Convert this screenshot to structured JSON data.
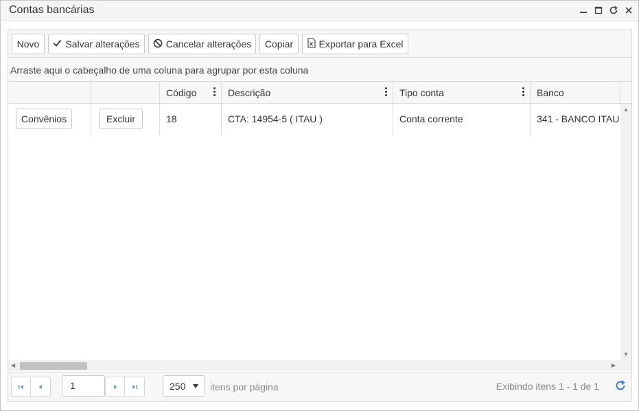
{
  "window": {
    "title": "Contas bancárias"
  },
  "toolbar": {
    "new_label": "Novo",
    "save_label": "Salvar alterações",
    "cancel_label": "Cancelar alterações",
    "copy_label": "Copiar",
    "export_label": "Exportar para Excel"
  },
  "grouping": {
    "hint": "Arraste aqui o cabeçalho de uma coluna para agrupar por esta coluna"
  },
  "columns": [
    {
      "label": ""
    },
    {
      "label": ""
    },
    {
      "label": "Código"
    },
    {
      "label": "Descrição"
    },
    {
      "label": "Tipo conta"
    },
    {
      "label": "Banco"
    }
  ],
  "rows": [
    {
      "convenios_label": "Convênios",
      "excluir_label": "Excluir",
      "codigo": "18",
      "descricao": "CTA: 14954-5 ( ITAU )",
      "tipo_conta": "Conta corrente",
      "banco": "341 - BANCO ITAU"
    }
  ],
  "pager": {
    "page": "1",
    "page_size": "250",
    "items_per_page_label": "itens por página",
    "info": "Exibindo itens 1 - 1 de 1"
  },
  "colors": {
    "accent": "#3f7fc8",
    "border": "#c9c9c9",
    "toolbar_bg": "#f7f7f7"
  }
}
